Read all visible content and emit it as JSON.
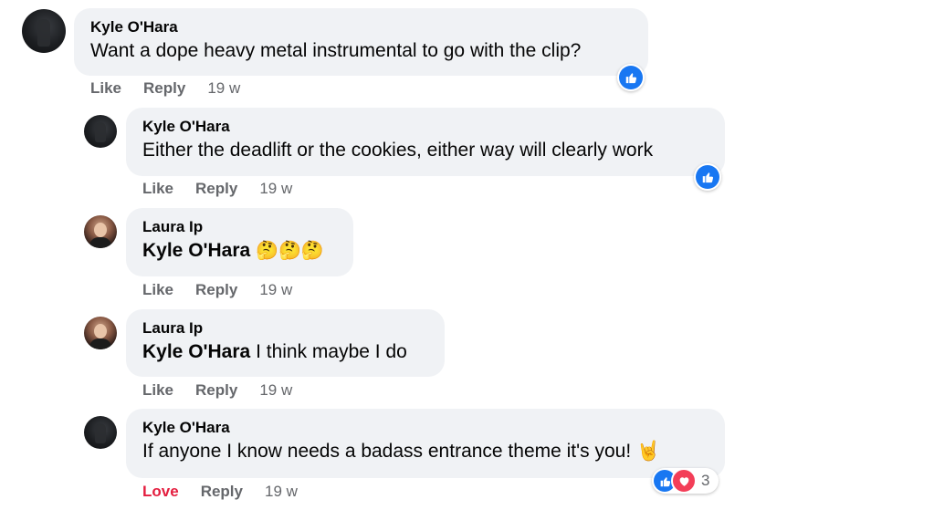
{
  "colors": {
    "bubble": "#f0f2f5",
    "action_text": "#65676b",
    "love_action": "#e41e3f",
    "like_badge": "#1877f2",
    "love_badge": "#f33e58"
  },
  "comments": [
    {
      "author": "Kyle O'Hara",
      "text": "Want a dope heavy metal instrumental to go with the clip?",
      "actions": {
        "like": "Like",
        "reply": "Reply",
        "time": "19 w"
      },
      "reactions": [
        "like-icon"
      ]
    },
    {
      "author": "Kyle O'Hara",
      "text": "Either the deadlift or the cookies, either way will clearly work",
      "actions": {
        "like": "Like",
        "reply": "Reply",
        "time": "19 w"
      },
      "reactions": [
        "like-icon"
      ]
    },
    {
      "author": "Laura Ip",
      "mention": "Kyle O'Hara",
      "text": "🤔🤔🤔",
      "actions": {
        "like": "Like",
        "reply": "Reply",
        "time": "19 w"
      }
    },
    {
      "author": "Laura Ip",
      "mention": "Kyle O'Hara",
      "text": "I think maybe I do",
      "actions": {
        "like": "Like",
        "reply": "Reply",
        "time": "19 w"
      }
    },
    {
      "author": "Kyle O'Hara",
      "text": "If anyone I know needs a badass entrance theme it's you! 🤘",
      "actions": {
        "love": "Love",
        "reply": "Reply",
        "time": "19 w"
      },
      "reactions": [
        "like-icon",
        "heart-icon"
      ],
      "reaction_count": "3"
    }
  ]
}
